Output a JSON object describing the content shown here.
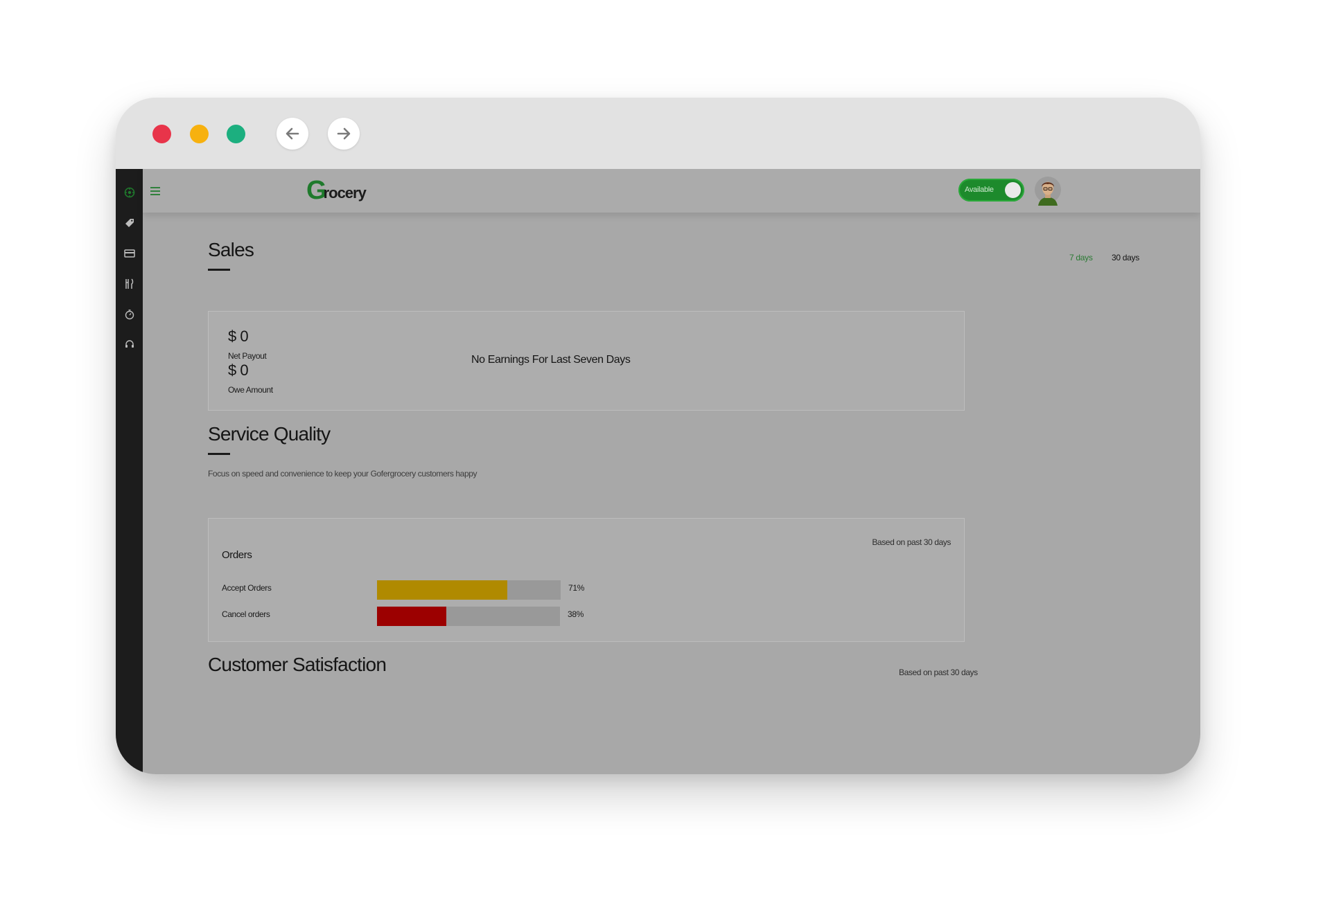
{
  "browser": {
    "back_icon": "arrow-left-icon",
    "forward_icon": "arrow-right-icon"
  },
  "sidebar": {
    "icons": [
      "dashboard-icon",
      "tag-icon",
      "card-icon",
      "utensils-icon",
      "timer-icon",
      "support-icon"
    ],
    "active_color": "#1f7a2c"
  },
  "header": {
    "logo_mark": "G",
    "logo_text": "rocery",
    "availability_label": "Available",
    "availability_on": true,
    "accent_color": "#1d8a2c"
  },
  "sales": {
    "title": "Sales",
    "range_tabs": [
      {
        "label": "7 days",
        "active": true,
        "color": "#2a7a33"
      },
      {
        "label": "30 days",
        "active": false,
        "color": "#141414"
      }
    ],
    "net_payout_amount": "$ 0",
    "net_payout_label": "Net Payout",
    "owe_amount": "$ 0",
    "owe_label": "Owe Amount",
    "empty_message": "No Earnings For Last Seven Days"
  },
  "service_quality": {
    "title": "Service Quality",
    "subtitle": "Focus on speed and convenience to keep your Gofergrocery customers happy",
    "orders_title": "Orders",
    "period_note": "Based on past 30 days",
    "metrics": [
      {
        "label": "Accept Orders",
        "percent_text": "71%",
        "value": 0.71,
        "color": "#b08a00"
      },
      {
        "label": "Cancel orders",
        "percent_text": "38%",
        "value": 0.38,
        "color": "#9c0000"
      }
    ]
  },
  "customer_satisfaction": {
    "title": "Customer Satisfaction",
    "period_note": "Based on past 30 days"
  }
}
